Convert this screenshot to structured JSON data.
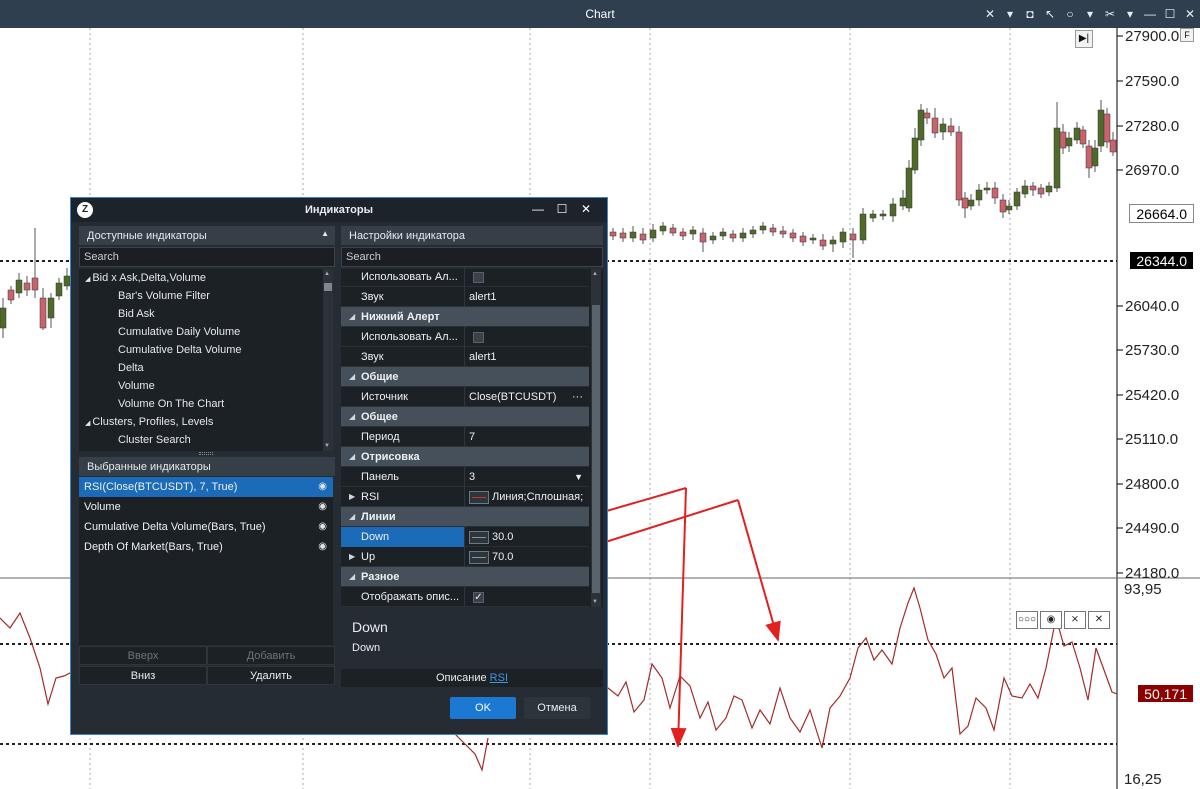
{
  "window": {
    "title": "Chart",
    "icons": [
      "crosshair-icon",
      "camera-icon",
      "circle-icon",
      "tools-icon",
      "minimize-icon",
      "maximize-icon",
      "close-icon"
    ]
  },
  "price_scale": {
    "labels": [
      "27900.0",
      "27590.0",
      "27280.0",
      "26970.0",
      "26040.0",
      "25730.0",
      "25420.0",
      "25110.0",
      "24800.0",
      "24490.0",
      "24180.0"
    ],
    "tag_last": "26664.0",
    "tag_line": "26344.0",
    "toggle_label": "F"
  },
  "rsi_scale": {
    "top": "93,95",
    "bottom": "16,25",
    "current": "50,171"
  },
  "dialog": {
    "title": "Индикаторы",
    "available_header": "Доступные индикаторы",
    "search_placeholder": "Search",
    "tree": [
      {
        "label": "Bid x Ask,Delta,Volume",
        "level": 0
      },
      {
        "label": "Bar's Volume Filter",
        "level": 1
      },
      {
        "label": "Bid Ask",
        "level": 1
      },
      {
        "label": "Cumulative Daily Volume",
        "level": 1
      },
      {
        "label": "Cumulative Delta Volume",
        "level": 1
      },
      {
        "label": "Delta",
        "level": 1
      },
      {
        "label": "Volume",
        "level": 1
      },
      {
        "label": "Volume On The Chart",
        "level": 1
      },
      {
        "label": "Clusters, Profiles, Levels",
        "level": 0
      },
      {
        "label": "Cluster Search",
        "level": 1
      }
    ],
    "selected_header": "Выбранные индикаторы",
    "selected": [
      "RSI(Close(BTCUSDT), 7, True)",
      "Volume",
      "Cumulative Delta Volume(Bars, True)",
      "Depth Of Market(Bars, True)"
    ],
    "btn_up": "Вверх",
    "btn_add": "Добавить",
    "btn_down": "Вниз",
    "btn_delete": "Удалить",
    "settings_header": "Настройки индикатора",
    "settings_search": "Search",
    "props": [
      {
        "type": "prop",
        "key": "Использовать Ал...",
        "value": "",
        "checkbox": true
      },
      {
        "type": "prop",
        "key": "Звук",
        "value": "alert1"
      },
      {
        "type": "cat",
        "key": "Нижний Алерт"
      },
      {
        "type": "prop",
        "key": "Использовать Ал...",
        "value": "",
        "checkbox": true
      },
      {
        "type": "prop",
        "key": "Звук",
        "value": "alert1"
      },
      {
        "type": "cat",
        "key": "Общие"
      },
      {
        "type": "prop",
        "key": "Источник",
        "value": "Close(BTCUSDT)",
        "ellipsis": "···"
      },
      {
        "type": "cat",
        "key": "Общее"
      },
      {
        "type": "prop",
        "key": "Период",
        "value": "7"
      },
      {
        "type": "cat",
        "key": "Отрисовка"
      },
      {
        "type": "prop",
        "key": "Панель",
        "value": "3",
        "dropdown": true
      },
      {
        "type": "prop",
        "key": "RSI",
        "value": "Линия;Сплошная;",
        "swatch": true,
        "expand": true
      },
      {
        "type": "cat",
        "key": "Линии"
      },
      {
        "type": "prop",
        "key": "Down",
        "value": "30.0",
        "swatch": true,
        "expand": true,
        "selected": true
      },
      {
        "type": "prop",
        "key": "Up",
        "value": "70.0",
        "swatch": true,
        "expand": true
      },
      {
        "type": "cat",
        "key": "Разное"
      },
      {
        "type": "prop",
        "key": "Отображать опис...",
        "value": "",
        "check": "✓"
      }
    ],
    "desc_title": "Down",
    "desc_text": "Down",
    "desc_label": "Описание",
    "desc_link": "RSI",
    "ok": "OK",
    "cancel": "Отмена"
  },
  "colors": {
    "bull": "#4f6b2a",
    "bear": "#c8626c",
    "rsi": "#a52a2a",
    "accent": "#1b79d3",
    "annotation": "#e32020"
  }
}
